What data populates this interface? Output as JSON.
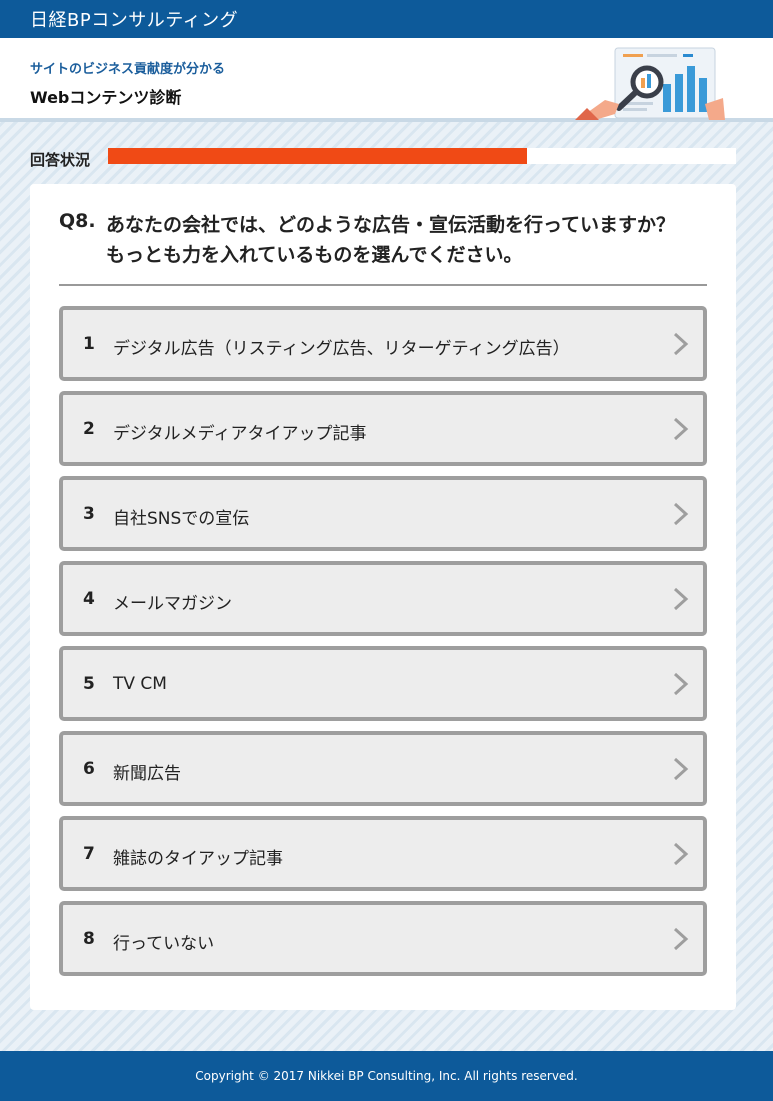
{
  "header": {
    "brand": "日経BPコンサルティング",
    "tagline": "サイトのビジネス貢献度が分かる",
    "title": "Webコンテンツ診断"
  },
  "progress": {
    "label": "回答状況",
    "fraction": 0.667
  },
  "question": {
    "number": "Q8.",
    "line1": "あなたの会社では、どのような広告・宣伝活動を行っていますか？",
    "line2": "もっとも力を入れているものを選んでください。"
  },
  "options": [
    {
      "num": "1",
      "label": "デジタル広告（リスティング広告、リターゲティング広告）"
    },
    {
      "num": "2",
      "label": "デジタルメディアタイアップ記事"
    },
    {
      "num": "3",
      "label": "自社SNSでの宣伝"
    },
    {
      "num": "4",
      "label": "メールマガジン"
    },
    {
      "num": "5",
      "label": "TV CM"
    },
    {
      "num": "6",
      "label": "新聞広告"
    },
    {
      "num": "7",
      "label": "雑誌のタイアップ記事"
    },
    {
      "num": "8",
      "label": "行っていない"
    }
  ],
  "footer": {
    "copyright": "Copyright © 2017 Nikkei BP Consulting, Inc. All rights reserved."
  },
  "colors": {
    "brand_blue": "#0d5a9a",
    "progress_orange": "#f04a15",
    "option_border": "#9e9e9e",
    "option_bg": "#ededed"
  },
  "icons": {
    "chevron": "chevron-right-icon",
    "illustration": "magnifier-chart-illustration"
  }
}
